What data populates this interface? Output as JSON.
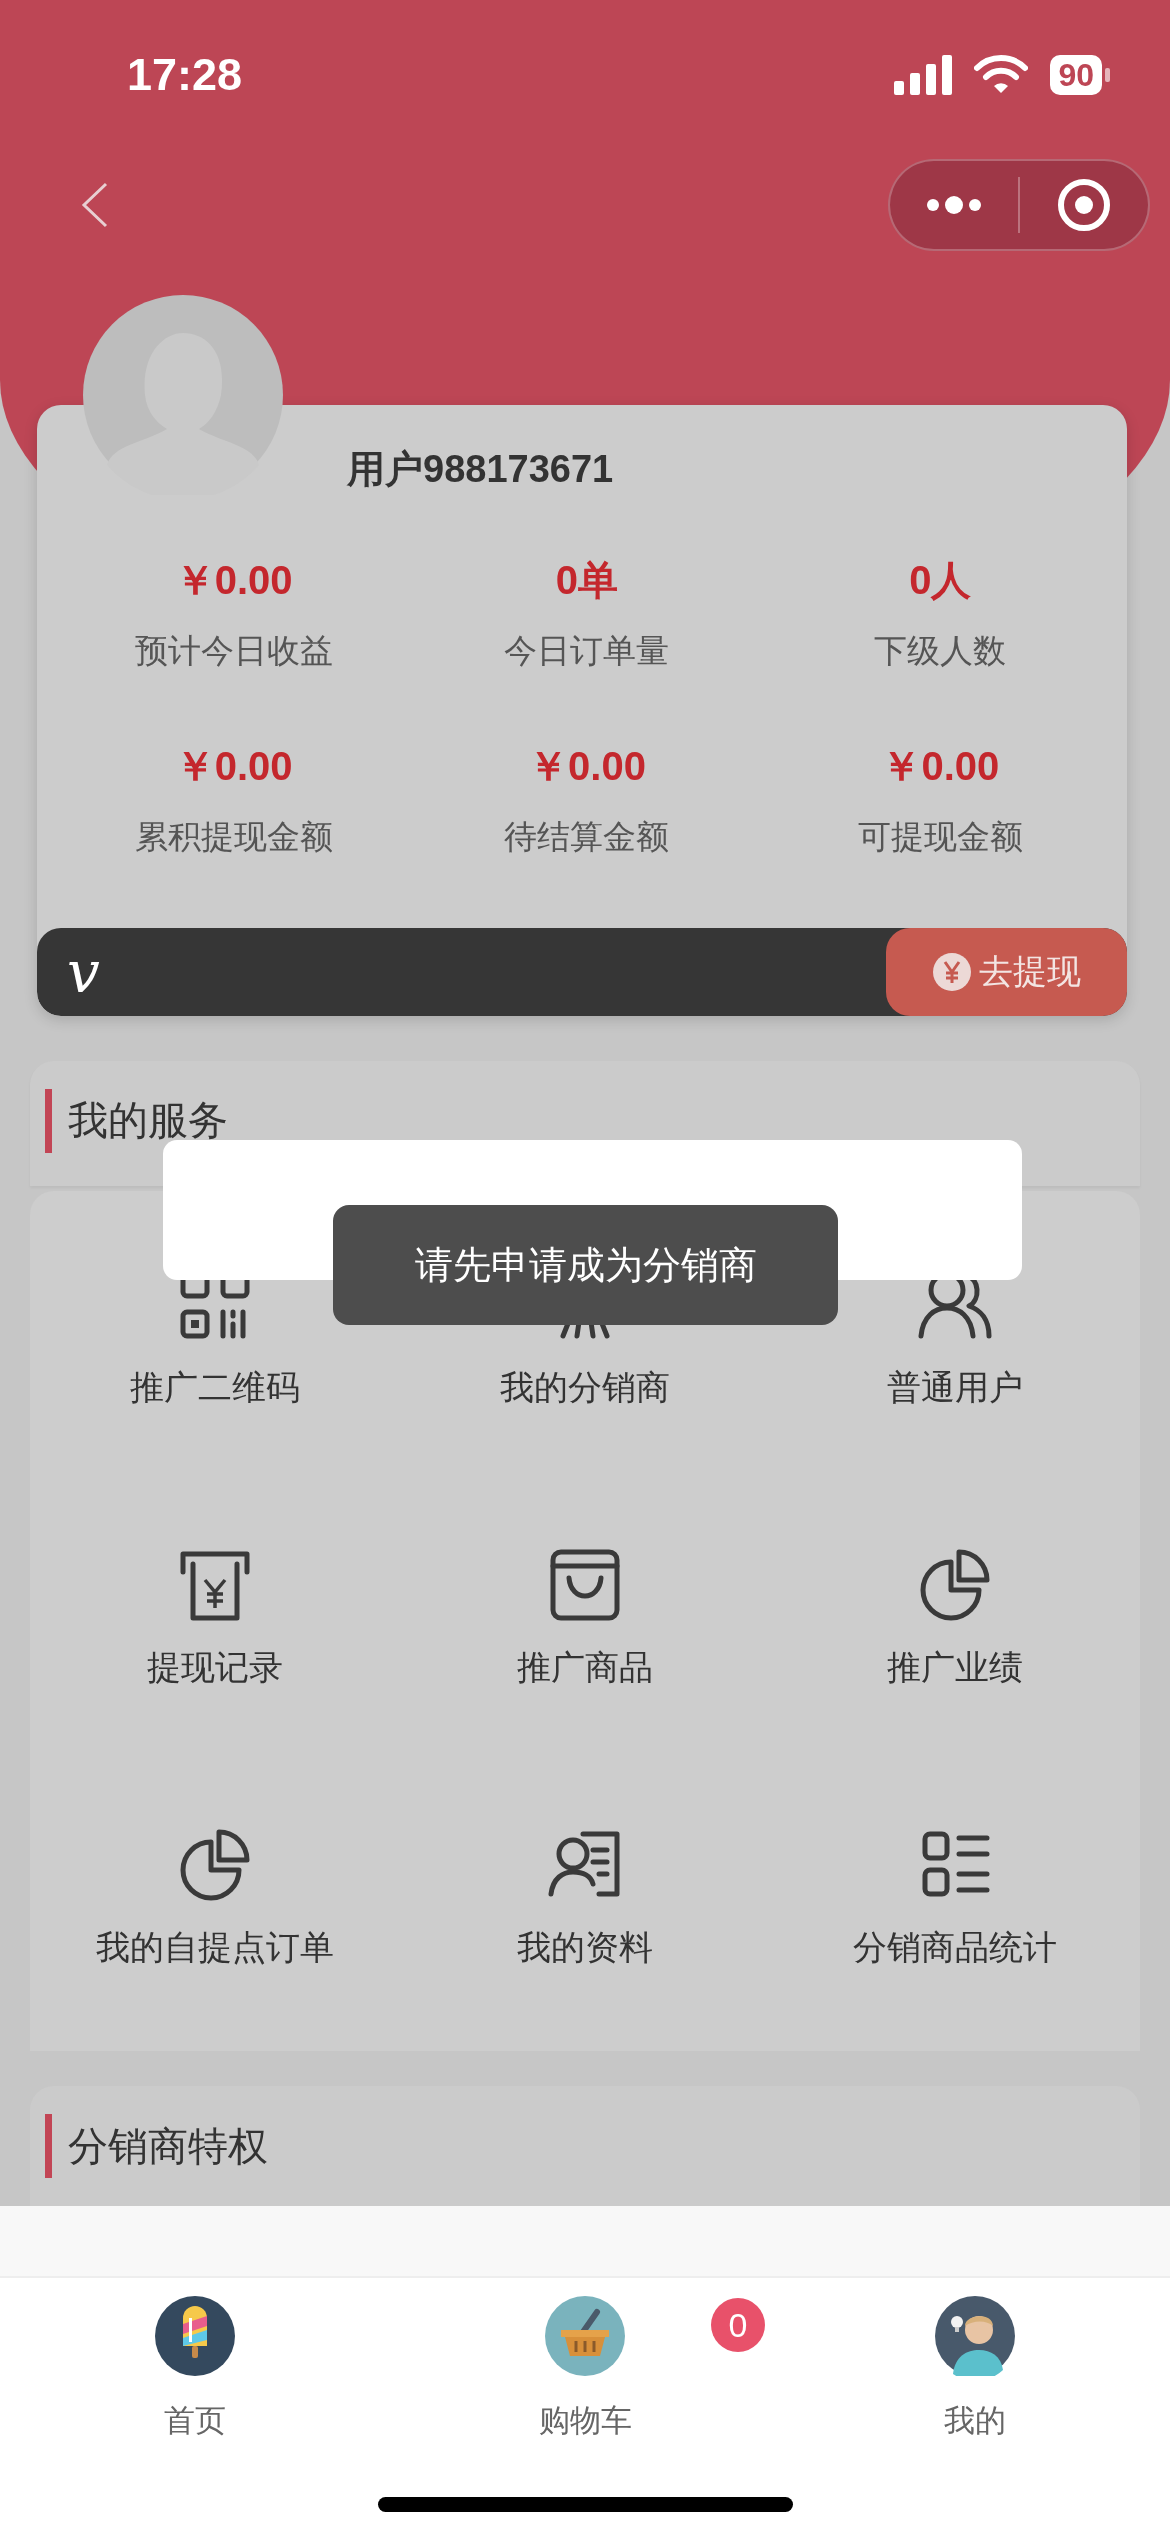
{
  "status_bar": {
    "time": "17:28",
    "battery": "90"
  },
  "profile": {
    "username": "用户988173671",
    "stats": [
      {
        "value": "￥0.00",
        "label": "预计今日收益"
      },
      {
        "value": "0单",
        "label": "今日订单量"
      },
      {
        "value": "0人",
        "label": "下级人数"
      },
      {
        "value": "￥0.00",
        "label": "累积提现金额"
      },
      {
        "value": "￥0.00",
        "label": "待结算金额"
      },
      {
        "value": "￥0.00",
        "label": "可提现金额"
      }
    ]
  },
  "withdraw_bar": {
    "logo": "v",
    "button": "去提现"
  },
  "services": {
    "title": "我的服务",
    "items": [
      {
        "label": "推广二维码"
      },
      {
        "label": "我的分销商"
      },
      {
        "label": "普通用户"
      },
      {
        "label": "提现记录"
      },
      {
        "label": "推广商品"
      },
      {
        "label": "推广业绩"
      },
      {
        "label": "我的自提点订单"
      },
      {
        "label": "我的资料"
      },
      {
        "label": "分销商品统计"
      }
    ]
  },
  "privileges": {
    "title": "分销商特权"
  },
  "popup": {
    "kind": "dialog"
  },
  "toast": {
    "text": "请先申请成为分销商"
  },
  "tab_bar": {
    "tabs": [
      {
        "label": "首页"
      },
      {
        "label": "购物车",
        "badge": "0"
      },
      {
        "label": "我的"
      }
    ]
  }
}
